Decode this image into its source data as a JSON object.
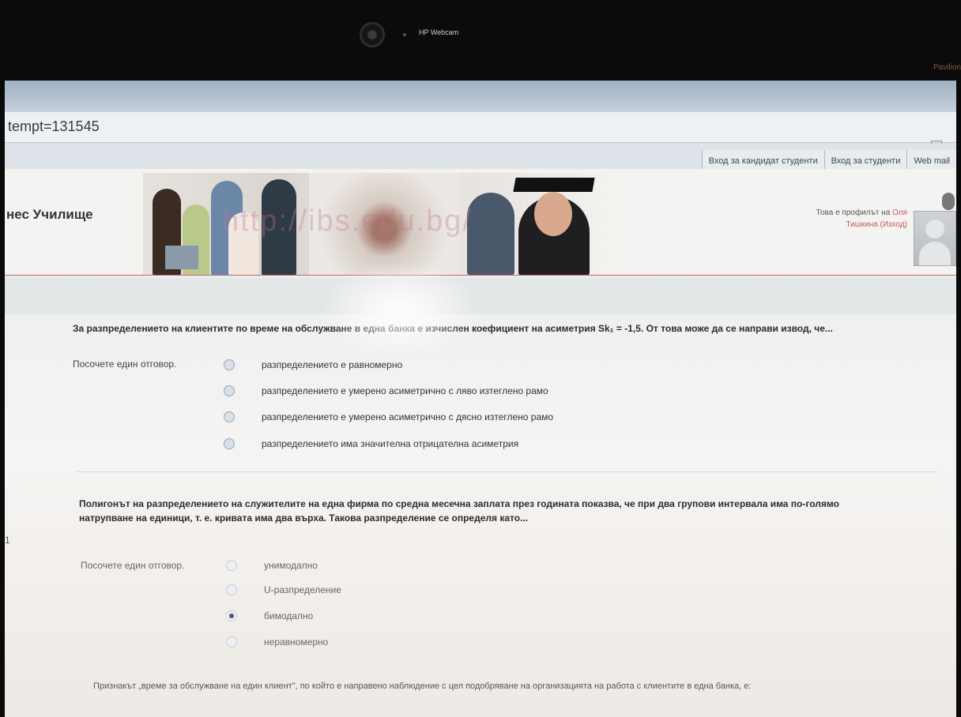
{
  "bezel": {
    "webcam_label": "HP Webcam",
    "right_text": "Pavilion"
  },
  "browser": {
    "url": "tempt=131545"
  },
  "top_links": [
    "Вход за кандидат студенти",
    "Вход за студенти",
    "Web mail"
  ],
  "header": {
    "school_name": "нес Училище",
    "banner_watermark": "http://ibs.edu.bg/",
    "profile_line1": "Това е профилът на",
    "profile_name_part1": "Оля",
    "profile_name_part2": "Тишкина",
    "profile_logout": "(Изход)"
  },
  "question1": {
    "text": "За разпределението на клиентите по време на обслужване в една банка е изчислен коефициент на асиметрия Sk₁ = -1,5. От това може да се направи извод, че...",
    "prompt": "Посочете един отговор.",
    "options": [
      "разпределението е равномерно",
      "разпределението е умерено асиметрично с ляво изтеглено рамо",
      "разпределението е умерено асиметрично с дясно изтеглено рамо",
      "разпределението има значителна отрицателна асиметрия"
    ]
  },
  "question2": {
    "text_line1": "Полигонът на разпределението на служителите на една фирма по средна месечна заплата през годината показва, че при два групови интервала има по-голямо",
    "text_line2": "натрупване на единици, т. е. кривата има два върха. Такова разпределение се определя като...",
    "prompt": "Посочете един отговор.",
    "options": [
      "унимодално",
      "U-разпределение",
      "бимодално",
      "неравномерно"
    ],
    "selected_index": 2
  },
  "question3": {
    "text": "Признакът „време за обслужване на един клиент\", по който е направено наблюдение с цел подобряване на организацията на работа с клиентите в една банка, е:"
  },
  "left_number": "1"
}
